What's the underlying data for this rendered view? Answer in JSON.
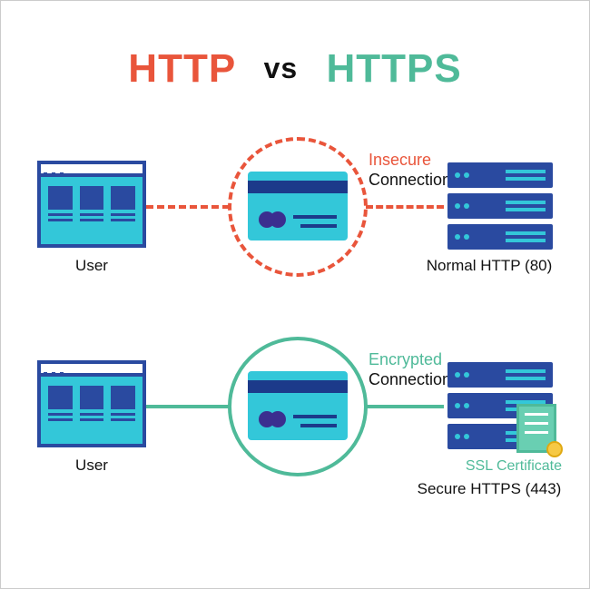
{
  "title": {
    "http": "HTTP",
    "vs": "vs",
    "https": "HTTPS"
  },
  "row1": {
    "user_label": "User",
    "conn_line1": "Insecure",
    "conn_line2": "Connection",
    "server_label": "Normal HTTP (80)"
  },
  "row2": {
    "user_label": "User",
    "conn_line1": "Encrypted",
    "conn_line2": "Connection",
    "ssl_label": "SSL Certificate",
    "server_label": "Secure HTTPS (443)"
  },
  "colors": {
    "http": "#e9553b",
    "https": "#4fba99",
    "server": "#2a4aa0",
    "accent": "#33c7d9"
  }
}
